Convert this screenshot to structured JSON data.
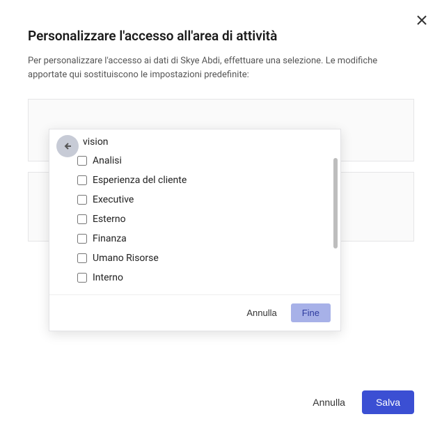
{
  "modal": {
    "title": "Personalizzare l'accesso all'area di attività",
    "description": "Per personalizzare l'accesso ai dati di Skye Abdi, effettuare una selezione. Le modifiche apportate qui sostituiscono le impostazioni predefinite:"
  },
  "popup": {
    "title_fragment": "vision",
    "options": [
      {
        "label": "Analisi",
        "checked": false
      },
      {
        "label": "Esperienza del cliente",
        "checked": false
      },
      {
        "label": "Executive",
        "checked": false
      },
      {
        "label": "Esterno",
        "checked": false
      },
      {
        "label": "Finanza",
        "checked": false
      },
      {
        "label": "Umano Risorse",
        "checked": false
      },
      {
        "label": "Interno",
        "checked": false
      }
    ],
    "cancel_label": "Annulla",
    "done_label": "Fine"
  },
  "footer": {
    "cancel_label": "Annulla",
    "save_label": "Salva"
  }
}
